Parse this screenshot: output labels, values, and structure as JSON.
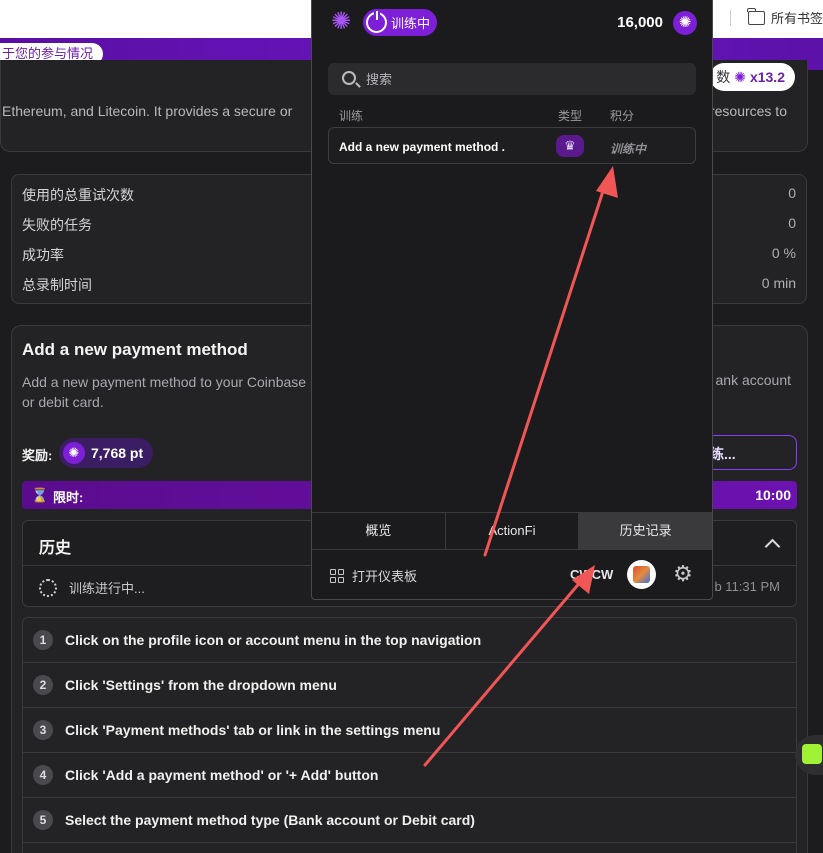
{
  "browser": {
    "bookmark_folder": "所有书签"
  },
  "banner": {
    "notice": "于您的参与情况"
  },
  "card": {
    "multiplier_prefix": "数",
    "multiplier": "x13.2",
    "description_left": "Ethereum, and Litecoin. It provides a secure or",
    "description_right": "resources to"
  },
  "stats": [
    {
      "label": "使用的总重试次数",
      "value": "0"
    },
    {
      "label": "失败的任务",
      "value": "0"
    },
    {
      "label": "成功率",
      "value": "0 %"
    },
    {
      "label": "总录制时间",
      "value": "0 min"
    }
  ],
  "task": {
    "title": "Add a new payment method",
    "description": "Add a new payment method to your Coinbase or debit card.",
    "description_right": "ank account",
    "reward_label": "奖励:",
    "reward_value": "7,768 pt",
    "train_button": "练...",
    "timer_label": "限时:",
    "timer_value": "10:00"
  },
  "history": {
    "title": "历史",
    "item": "训练进行中...",
    "time": "b 11:31 PM"
  },
  "steps": [
    {
      "num": "1",
      "text": "Click on the profile icon or account menu in the top navigation"
    },
    {
      "num": "2",
      "text": "Click 'Settings' from the dropdown menu"
    },
    {
      "num": "3",
      "text": "Click 'Payment methods' tab or link in the settings menu"
    },
    {
      "num": "4",
      "text": "Click 'Add a payment method' or '+ Add' button"
    },
    {
      "num": "5",
      "text": "Select the payment method type (Bank account or Debit card)"
    }
  ],
  "popup": {
    "status": "训练中",
    "points": "16,000",
    "search_placeholder": "搜索",
    "columns": {
      "task": "训练",
      "type": "类型",
      "points": "积分"
    },
    "rows": [
      {
        "name": "Add a new payment method .",
        "status": "训练中"
      }
    ],
    "tabs": [
      "概览",
      "ActionFi",
      "历史记录"
    ],
    "active_tab": "历史记录",
    "dashboard_link": "打开仪表板",
    "username": "CWCW"
  },
  "colors": {
    "accent": "#7c1fd6",
    "banner": "#6a15c0",
    "annotation_arrow": "#f05656"
  }
}
